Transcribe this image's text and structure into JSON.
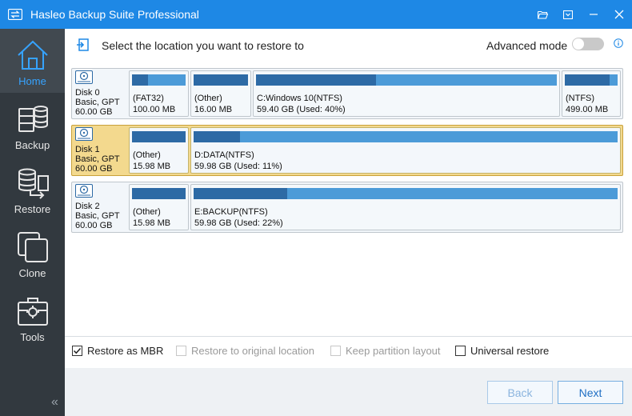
{
  "window": {
    "title": "Hasleo Backup Suite Professional"
  },
  "titlebar_icons": [
    "folder-open-icon",
    "dropdown-icon",
    "minimize-icon",
    "close-icon"
  ],
  "sidebar": {
    "items": [
      {
        "label": "Home",
        "icon": "home-icon",
        "active": true
      },
      {
        "label": "Backup",
        "icon": "backup-icon"
      },
      {
        "label": "Restore",
        "icon": "restore-icon"
      },
      {
        "label": "Clone",
        "icon": "clone-icon"
      },
      {
        "label": "Tools",
        "icon": "tools-icon"
      }
    ]
  },
  "header": {
    "instruction": "Select the location you want to restore to",
    "advanced_mode_label": "Advanced mode",
    "advanced_mode_on": false
  },
  "disks": [
    {
      "name": "Disk 0",
      "type": "Basic, GPT",
      "size": "60.00 GB",
      "selected": false,
      "partitions": [
        {
          "label": "(FAT32)",
          "size": "100.00 MB",
          "used_fraction": 0.3
        },
        {
          "label": "(Other)",
          "size": "16.00 MB",
          "used_fraction": 1.0
        },
        {
          "label": "C:Windows 10(NTFS)",
          "size": "59.40 GB (Used: 40%)",
          "used_fraction": 0.4
        },
        {
          "label": "(NTFS)",
          "size": "499.00 MB",
          "used_fraction": 0.85
        }
      ]
    },
    {
      "name": "Disk 1",
      "type": "Basic, GPT",
      "size": "60.00 GB",
      "selected": true,
      "partitions": [
        {
          "label": "(Other)",
          "size": "15.98 MB",
          "used_fraction": 1.0
        },
        {
          "label": "D:DATA(NTFS)",
          "size": "59.98 GB (Used: 11%)",
          "used_fraction": 0.11
        }
      ]
    },
    {
      "name": "Disk 2",
      "type": "Basic, GPT",
      "size": "60.00 GB",
      "selected": false,
      "partitions": [
        {
          "label": "(Other)",
          "size": "15.98 MB",
          "used_fraction": 1.0
        },
        {
          "label": "E:BACKUP(NTFS)",
          "size": "59.98 GB (Used: 22%)",
          "used_fraction": 0.22
        }
      ]
    }
  ],
  "options": {
    "restore_as_mbr": {
      "label": "Restore as MBR",
      "checked": true,
      "enabled": true
    },
    "restore_original": {
      "label": "Restore to original location",
      "checked": false,
      "enabled": false
    },
    "keep_layout": {
      "label": "Keep partition layout",
      "checked": false,
      "enabled": false
    },
    "universal_restore": {
      "label": "Universal restore",
      "checked": false,
      "enabled": true
    }
  },
  "buttons": {
    "back": "Back",
    "next": "Next"
  },
  "colors": {
    "titlebar": "#1e88e5",
    "sidebar": "#32393f",
    "active_nav": "#36a3ff",
    "selected_disk": "#f3d98e",
    "bar_free": "#4c9bd8",
    "bar_used": "#2d6aa5"
  }
}
